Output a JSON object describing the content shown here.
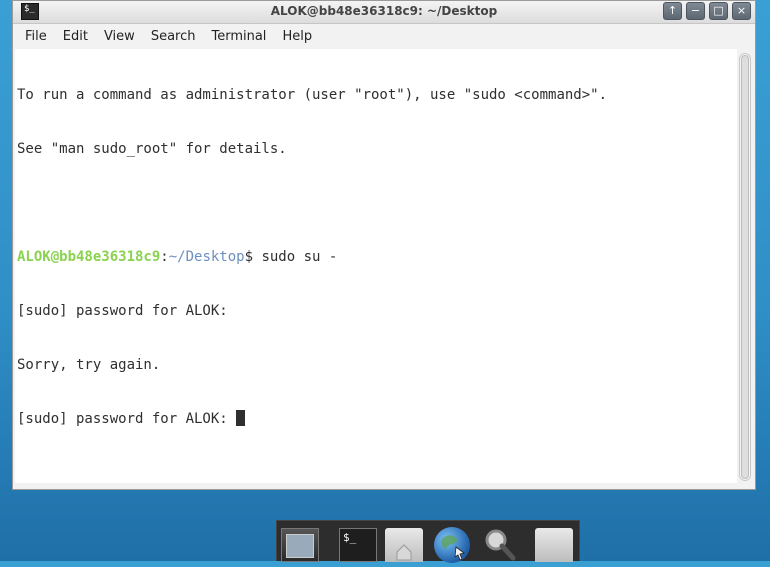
{
  "window": {
    "title": "ALOK@bb48e36318c9: ~/Desktop",
    "app_icon_label": "$_",
    "controls": [
      "↑",
      "−",
      "□",
      "×"
    ]
  },
  "menu": [
    "File",
    "Edit",
    "View",
    "Search",
    "Terminal",
    "Help"
  ],
  "terminal": {
    "lines": [
      "To run a command as administrator (user \"root\"), use \"sudo <command>\".",
      "See \"man sudo_root\" for details.",
      "",
      "",
      "[sudo] password for ALOK:",
      "Sorry, try again.",
      "[sudo] password for ALOK: "
    ],
    "prompt_user": "ALOK@bb48e36318c9",
    "prompt_sep": ":",
    "prompt_path": "~/Desktop",
    "prompt_symbol": "$ ",
    "command": "sudo su -"
  },
  "dock": {
    "icons": [
      "window-icon",
      "terminal-icon",
      "home-folder-icon",
      "web-browser-icon",
      "search-icon",
      "files-icon"
    ],
    "terminal_label": "$_"
  },
  "colors": {
    "prompt_user": "#8ad34f",
    "prompt_path": "#6b8fbf",
    "desktop": "#2f8fc6"
  }
}
